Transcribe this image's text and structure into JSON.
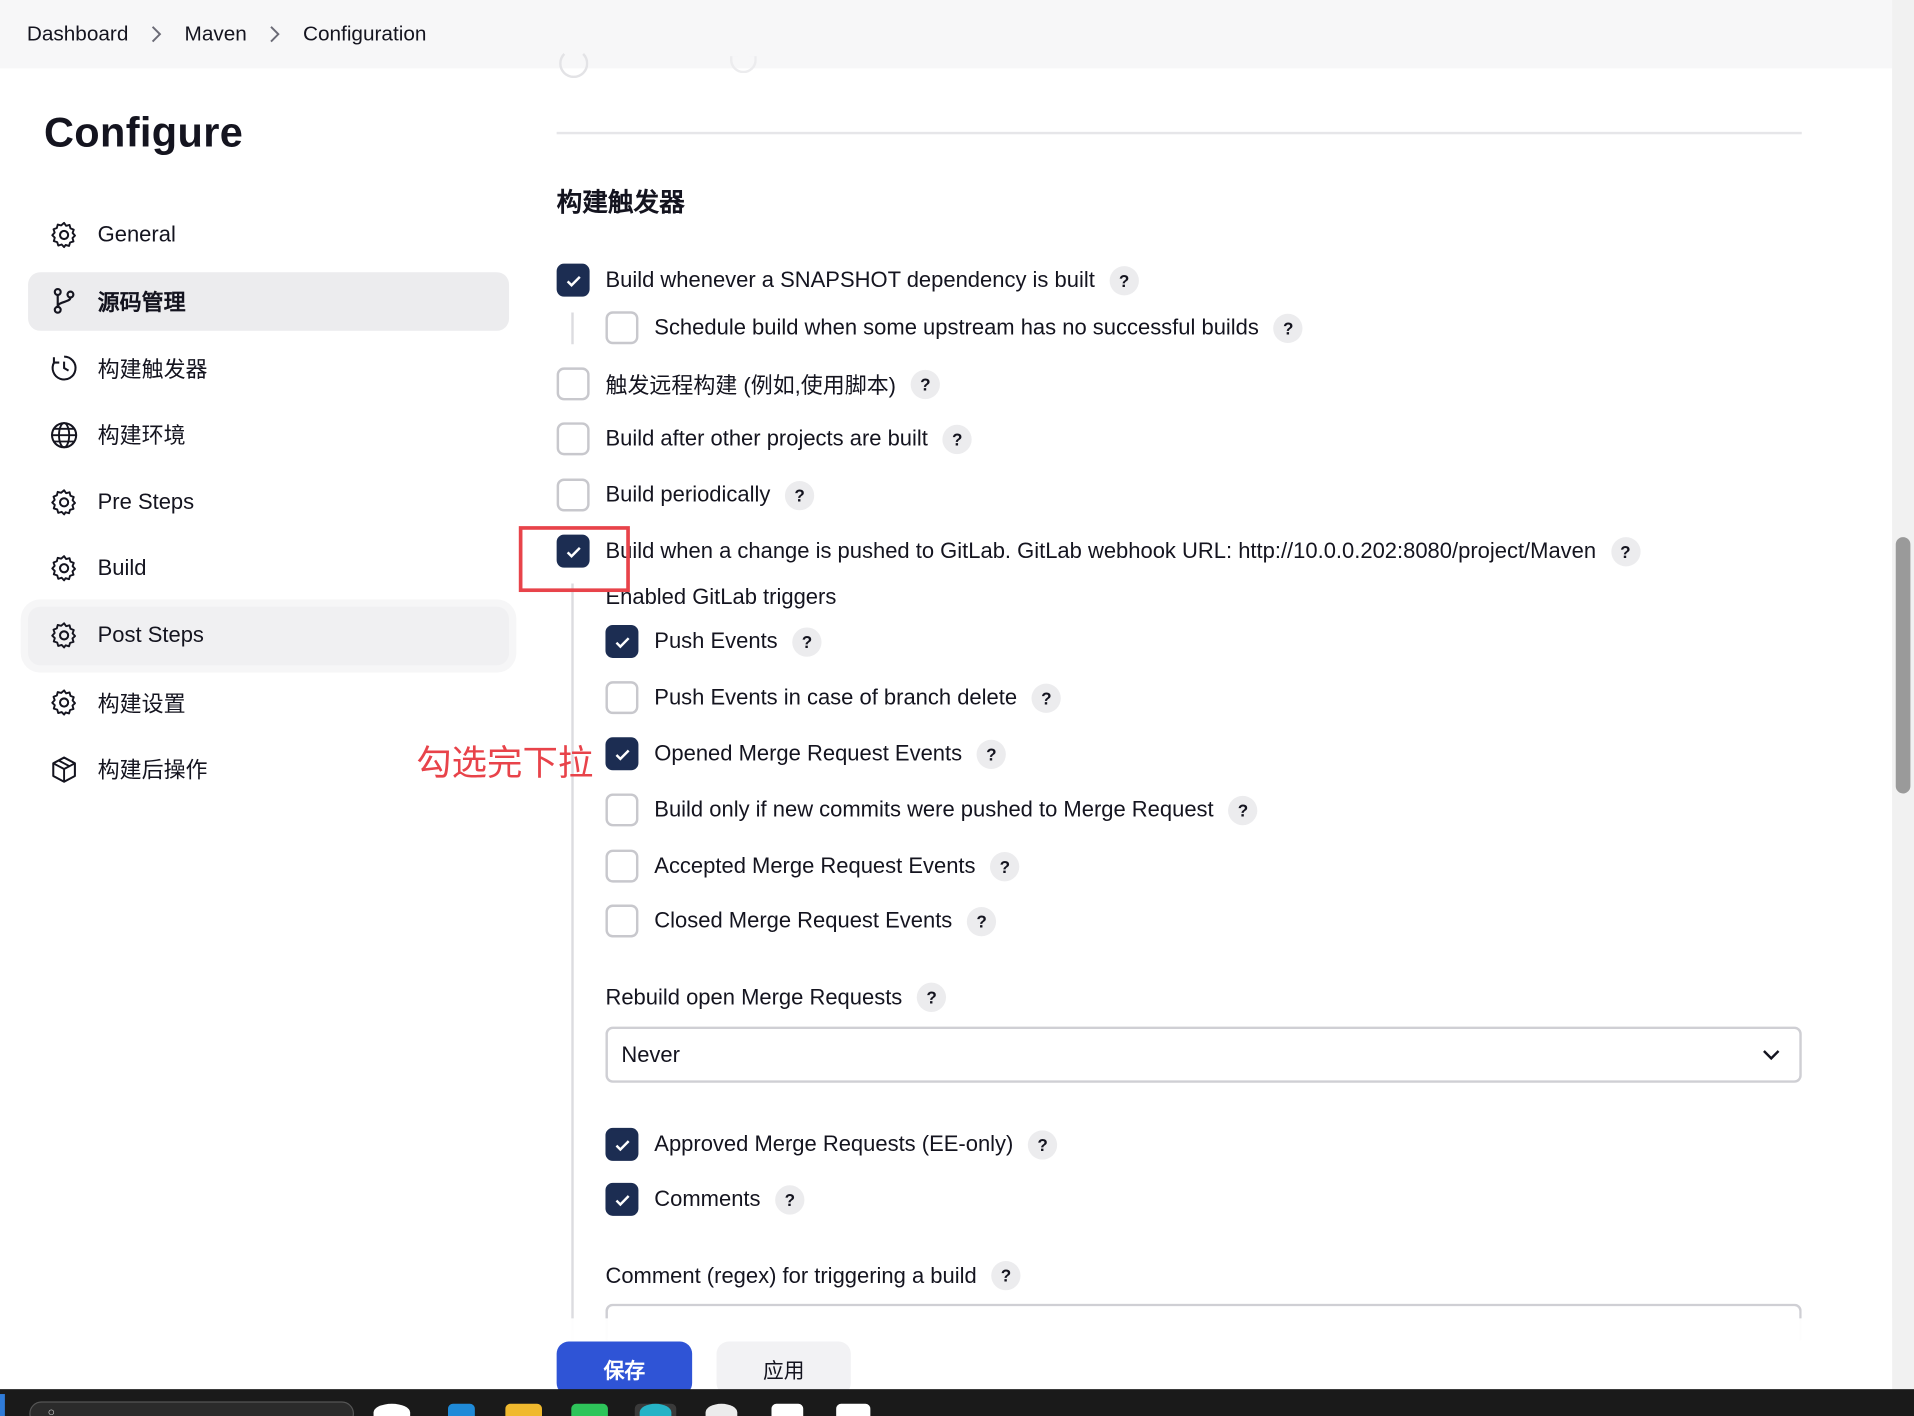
{
  "breadcrumb": {
    "items": [
      "Dashboard",
      "Maven",
      "Configuration"
    ]
  },
  "page": {
    "title": "Configure"
  },
  "sidebar": {
    "items": [
      {
        "label": "General",
        "icon": "gear-icon"
      },
      {
        "label": "源码管理",
        "icon": "branch-icon"
      },
      {
        "label": "构建触发器",
        "icon": "clock-icon"
      },
      {
        "label": "构建环境",
        "icon": "globe-icon"
      },
      {
        "label": "Pre Steps",
        "icon": "gear-icon"
      },
      {
        "label": "Build",
        "icon": "gear-icon"
      },
      {
        "label": "Post Steps",
        "icon": "gear-icon"
      },
      {
        "label": "构建设置",
        "icon": "gear-icon"
      },
      {
        "label": "构建后操作",
        "icon": "cube-icon"
      }
    ],
    "active_index": 1
  },
  "section": {
    "title": "构建触发器"
  },
  "triggers": {
    "snapshot": {
      "label": "Build whenever a SNAPSHOT dependency is built",
      "checked": true
    },
    "schedule_upstream": {
      "label": "Schedule build when some upstream has no successful builds",
      "checked": false
    },
    "remote": {
      "label": "触发远程构建 (例如,使用脚本)",
      "checked": false
    },
    "after_other": {
      "label": "Build after other projects are built",
      "checked": false
    },
    "periodically": {
      "label": "Build periodically",
      "checked": false
    },
    "gitlab": {
      "label": "Build when a change is pushed to GitLab. GitLab webhook URL: http://10.0.0.202:8080/project/Maven",
      "checked": true
    }
  },
  "gitlab_triggers": {
    "heading": "Enabled GitLab triggers",
    "push_events": {
      "label": "Push Events",
      "checked": true
    },
    "push_branch_delete": {
      "label": "Push Events in case of branch delete",
      "checked": false
    },
    "opened_mr": {
      "label": "Opened Merge Request Events",
      "checked": true
    },
    "new_commits_mr": {
      "label": "Build only if new commits were pushed to Merge Request",
      "checked": false
    },
    "accepted_mr": {
      "label": "Accepted Merge Request Events",
      "checked": false
    },
    "closed_mr": {
      "label": "Closed Merge Request Events",
      "checked": false
    },
    "rebuild_label": "Rebuild open Merge Requests",
    "rebuild_value": "Never",
    "approved_mr": {
      "label": "Approved Merge Requests (EE-only)",
      "checked": true
    },
    "comments": {
      "label": "Comments",
      "checked": true
    },
    "comment_regex_label": "Comment (regex) for triggering a build"
  },
  "help_glyph": "?",
  "annotation": {
    "text": "勾选完下拉",
    "color": "#e8434a"
  },
  "actions": {
    "save": "保存",
    "apply": "应用"
  },
  "colors": {
    "checkbox_checked": "#1c2d52",
    "primary_button": "#2f54d6",
    "breadcrumb_bg": "#f7f7f8"
  }
}
